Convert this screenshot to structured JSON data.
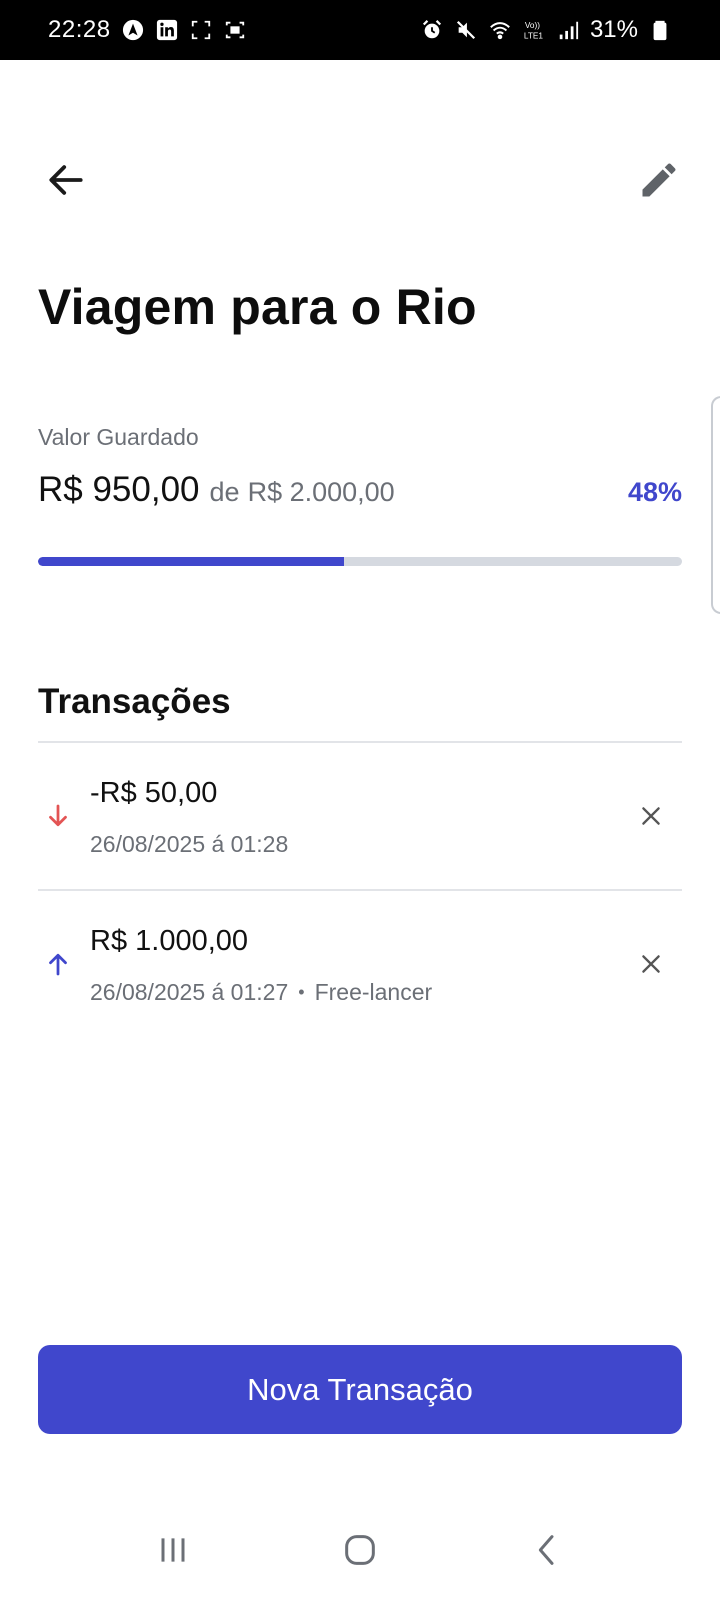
{
  "status_bar": {
    "time": "22:28",
    "battery": "31%",
    "icons": [
      "navigation-icon",
      "linkedin-icon",
      "screenshot-icon",
      "screen-record-icon",
      "alarm-icon",
      "mute-icon",
      "wifi-icon",
      "volte-icon",
      "signal-icon",
      "battery-icon"
    ]
  },
  "header": {
    "back_icon": "arrow-back-icon",
    "edit_icon": "pencil-icon",
    "title": "Viagem para o Rio"
  },
  "goal": {
    "saved_label": "Valor Guardado",
    "current_amount": "R$ 950,00",
    "of_label": "de",
    "target_amount": "R$ 2.000,00",
    "percent_label": "48%",
    "progress_fraction": 0.475
  },
  "transactions": {
    "title": "Transações",
    "items": [
      {
        "direction": "down",
        "icon": "arrow-down-icon",
        "amount": "-R$ 50,00",
        "date": "26/08/2025 á 01:28",
        "category": "",
        "delete_icon": "close-icon"
      },
      {
        "direction": "up",
        "icon": "arrow-up-icon",
        "amount": "R$ 1.000,00",
        "date": "26/08/2025 á 01:27",
        "category": "Free-lancer",
        "delete_icon": "close-icon"
      }
    ]
  },
  "actions": {
    "new_transaction_label": "Nova Transação"
  },
  "nav_bar": {
    "icons": [
      "recent-apps-icon",
      "home-icon",
      "back-icon"
    ]
  },
  "colors": {
    "accent": "#4047cc",
    "expense": "#e35454",
    "muted_text": "#6b6f76",
    "track": "#d5d9e0",
    "divider": "#e2e4e8"
  }
}
